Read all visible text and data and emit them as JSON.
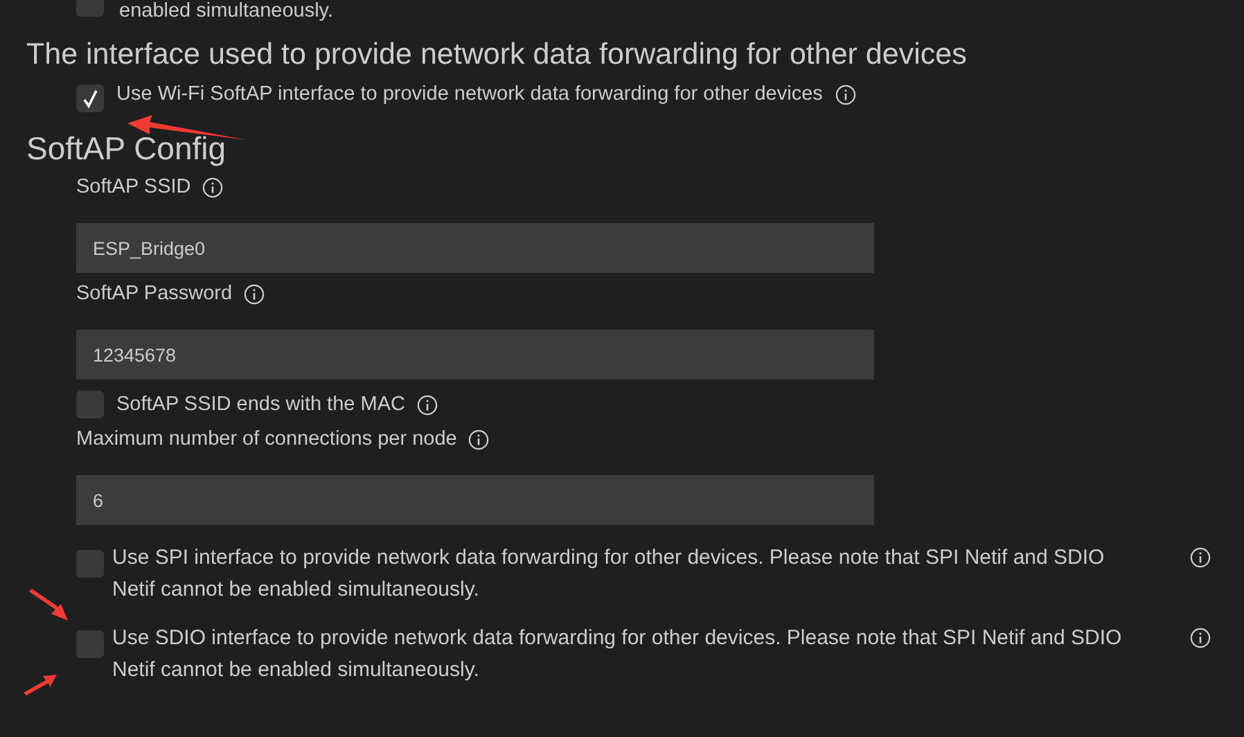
{
  "top_option": {
    "label": "enabled simultaneously.",
    "checked": false
  },
  "interface_section": {
    "title": "The interface used to provide network data forwarding for other devices",
    "option": {
      "label": "Use Wi-Fi SoftAP interface to provide network data forwarding for other devices",
      "checked": true
    }
  },
  "softap_config": {
    "title": "SoftAP Config",
    "fields": [
      {
        "kind": "text",
        "label": "SoftAP SSID",
        "value": "ESP_Bridge0"
      },
      {
        "kind": "text",
        "label": "SoftAP Password",
        "value": "12345678"
      },
      {
        "kind": "checkbox",
        "label": "SoftAP SSID ends with the MAC",
        "checked": false
      },
      {
        "kind": "text",
        "label": "Maximum number of connections per node",
        "value": "6"
      }
    ]
  },
  "other_options": [
    {
      "label": "Use SPI interface to provide network data forwarding for other devices. Please note that SPI Netif and SDIO Netif cannot be enabled simultaneously.",
      "checked": false
    },
    {
      "label": "Use SDIO interface to provide network data forwarding for other devices. Please note that SPI Netif and SDIO Netif cannot be enabled simultaneously.",
      "checked": false
    }
  ]
}
